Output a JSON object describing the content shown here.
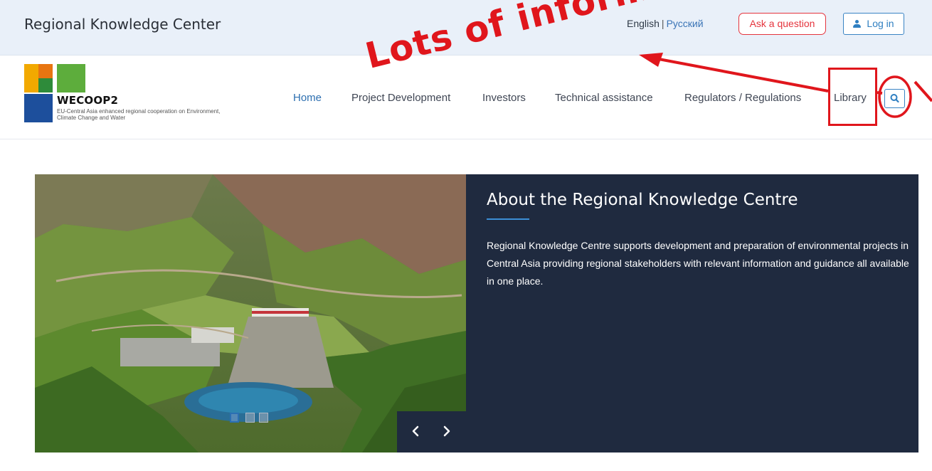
{
  "topbar": {
    "site_title": "Regional Knowledge Center",
    "lang_en": "English",
    "lang_sep": "|",
    "lang_ru": "Русский",
    "ask_label": "Ask a question",
    "login_label": "Log in"
  },
  "logo": {
    "name": "WECOOP2",
    "tagline": "EU-Central Asia enhanced regional cooperation on Environment, Climate Change and Water"
  },
  "nav": {
    "items": [
      "Home",
      "Project Development",
      "Investors",
      "Technical assistance",
      "Regulators / Regulations",
      "Library"
    ],
    "active": "Home"
  },
  "hero": {
    "title": "About the Regional Knowledge Centre",
    "text": "Regional Knowledge Centre supports development and preparation of environmental projects in Central Asia providing regional stakeholders with relevant information and guidance all available in one place.",
    "slides_count": 3,
    "active_slide": 1
  },
  "annotation": {
    "text": "Lots of informatio",
    "color": "#e0161c"
  },
  "colors": {
    "topbar_bg": "#e9f0f9",
    "panel_bg": "#1f2a3f",
    "accent_blue": "#2d6fb0",
    "ask_red": "#e5343d"
  },
  "icons": {
    "login": "user-icon",
    "search": "search-icon",
    "prev": "chevron-left-icon",
    "next": "chevron-right-icon"
  }
}
